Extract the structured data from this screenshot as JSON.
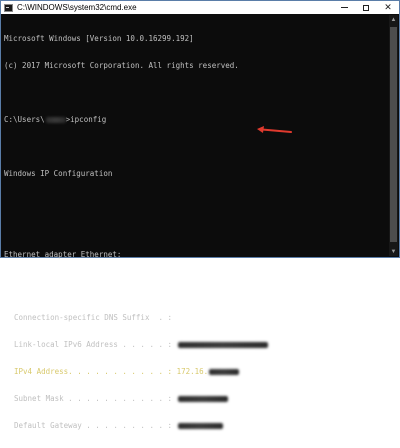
{
  "window": {
    "title": "C:\\WINDOWS\\system32\\cmd.exe"
  },
  "console": {
    "banner_line1": "Microsoft Windows [Version 10.0.16299.192]",
    "banner_line2": "(c) 2017 Microsoft Corporation. All rights reserved.",
    "prompt_prefix": "C:\\Users\\",
    "prompt_suffix": ">ipconfig",
    "ip_config_header": "Windows IP Configuration",
    "adapter_header": "Ethernet adapter Ethernet:",
    "rows": [
      {
        "label": "Connection-specific DNS Suffix  . :",
        "value": ""
      },
      {
        "label": "Link-local IPv6 Address . . . . . :",
        "value": ""
      },
      {
        "label": "IPv4 Address. . . . . . . . . . . :",
        "value": "172.16."
      },
      {
        "label": "Subnet Mask . . . . . . . . . . . :",
        "value": ""
      },
      {
        "label": "Default Gateway . . . . . . . . . :",
        "value": ""
      }
    ]
  },
  "colors": {
    "console_background": "#0c0c0c",
    "console_text": "#c0c0c0",
    "highlight_text": "#d8c96c",
    "arrow": "#e03a2e"
  },
  "icons": {
    "app": "cmd-icon",
    "minimize": "minimize-icon",
    "maximize": "maximize-icon",
    "close": "close-icon",
    "annotation": "red-arrow-icon"
  }
}
